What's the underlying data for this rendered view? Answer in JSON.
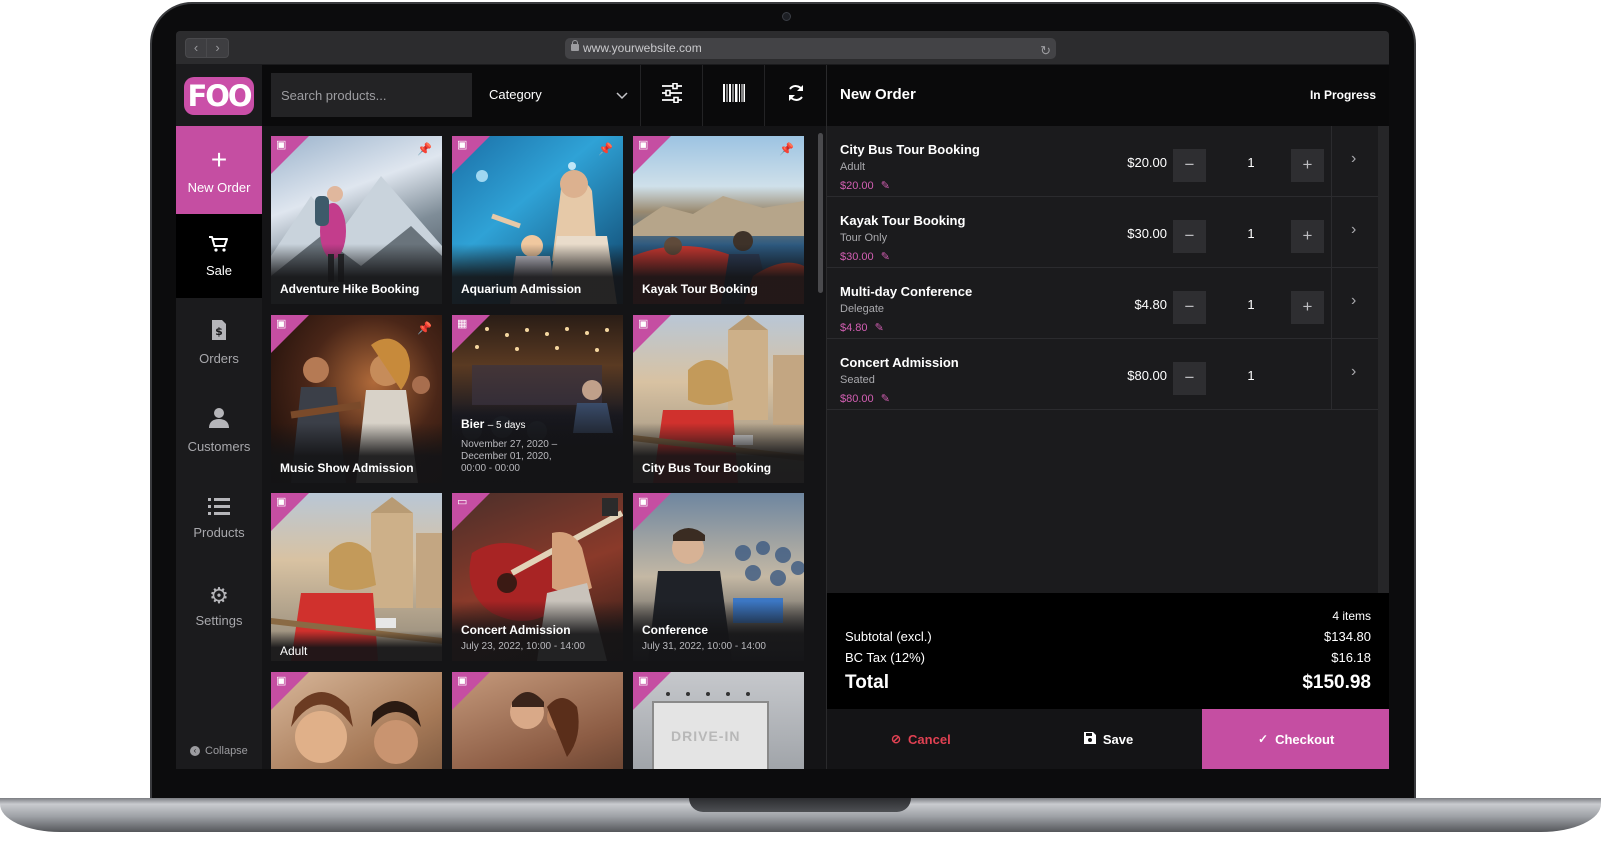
{
  "browser": {
    "url": "www.yourwebsite.com"
  },
  "brand": {
    "logo_text": "FOO",
    "accent": "#c54ea2"
  },
  "sidebar": {
    "items": [
      {
        "label": "New Order",
        "icon": "plus-icon"
      },
      {
        "label": "Sale",
        "icon": "cart-icon"
      },
      {
        "label": "Orders",
        "icon": "invoice-icon"
      },
      {
        "label": "Customers",
        "icon": "user-icon"
      },
      {
        "label": "Products",
        "icon": "list-icon"
      },
      {
        "label": "Settings",
        "icon": "gear-icon"
      }
    ],
    "collapse_label": "Collapse"
  },
  "toolbar": {
    "search_placeholder": "Search products...",
    "category_label": "Category"
  },
  "products": [
    {
      "title": "Adventure Hike Booking"
    },
    {
      "title": "Aquarium Admission"
    },
    {
      "title": "Kayak Tour Booking"
    },
    {
      "title": "Music Show Admission"
    },
    {
      "title": "Bier",
      "badge": "– 5 days",
      "sub1": "November 27, 2020 –",
      "sub2": "December 01, 2020,",
      "sub3": "00:00 - 00:00"
    },
    {
      "title": "City Bus Tour Booking"
    },
    {
      "title": "Adult"
    },
    {
      "title": "Concert Admission",
      "sub": "July 23, 2022, 10:00 - 14:00"
    },
    {
      "title": "Conference",
      "sub": "July 31, 2022, 10:00 - 14:00"
    },
    {
      "title": ""
    },
    {
      "title": ""
    },
    {
      "title": "",
      "sign": "DRIVE-IN"
    }
  ],
  "order": {
    "title": "New Order",
    "status": "In Progress",
    "lines": [
      {
        "name": "City Bus Tour Booking",
        "variant": "Adult",
        "unit_price": "$20.00",
        "total": "$20.00",
        "qty": "1",
        "minus": "−",
        "plus": "+"
      },
      {
        "name": "Kayak Tour Booking",
        "variant": "Tour Only",
        "unit_price": "$30.00",
        "total": "$30.00",
        "qty": "1",
        "minus": "−",
        "plus": "+"
      },
      {
        "name": "Multi-day Conference",
        "variant": "Delegate",
        "unit_price": "$4.80",
        "total": "$4.80",
        "qty": "1",
        "minus": "−",
        "plus": "+"
      },
      {
        "name": "Concert Admission",
        "variant": "Seated",
        "unit_price": "$80.00",
        "total": "$80.00",
        "qty": "1",
        "minus": "−"
      }
    ],
    "summary": {
      "items": "4 items",
      "subtotal_label": "Subtotal (excl.)",
      "subtotal": "$134.80",
      "tax_label": "BC Tax (12%)",
      "tax": "$16.18",
      "total_label": "Total",
      "total": "$150.98"
    },
    "actions": {
      "cancel": "Cancel",
      "save": "Save",
      "checkout": "Checkout"
    }
  }
}
